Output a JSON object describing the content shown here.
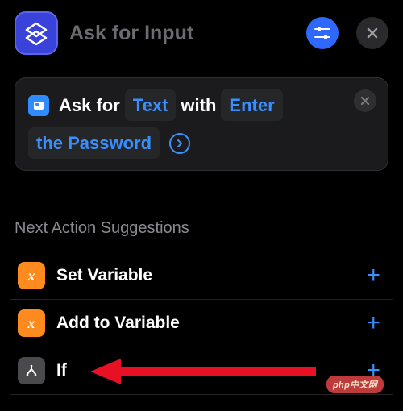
{
  "header": {
    "title": "Ask for Input"
  },
  "card": {
    "prefix": "Ask for",
    "type_token": "Text",
    "middle": "with",
    "prompt_token_1": "Enter",
    "prompt_token_2": "the Password"
  },
  "section_title": "Next Action Suggestions",
  "suggestions": [
    {
      "label": "Set Variable",
      "icon": "x",
      "icon_class": "orange"
    },
    {
      "label": "Add to Variable",
      "icon": "x",
      "icon_class": "orange"
    },
    {
      "label": "If",
      "icon": "branch",
      "icon_class": "gray"
    }
  ],
  "watermark": "php中文网"
}
